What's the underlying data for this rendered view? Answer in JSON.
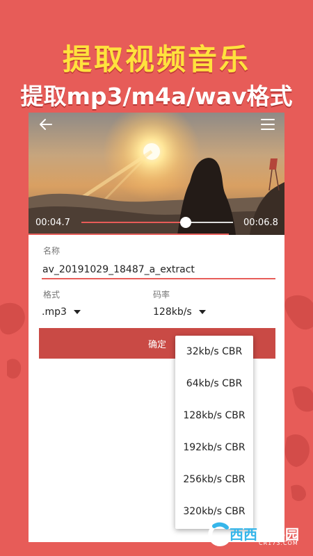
{
  "promo": {
    "headline": "提取视频音乐",
    "subheadline": "提取mp3/m4a/wav格式"
  },
  "player": {
    "current_time": "00:04.7",
    "total_time": "00:06.8",
    "progress": 0.69,
    "back_icon": "arrow-left-icon",
    "menu_icon": "hamburger-menu-icon"
  },
  "form": {
    "name_label": "名称",
    "name_value": "av_20191029_18487_a_extract",
    "format_label": "格式",
    "format_value": ".mp3",
    "bitrate_label": "码率",
    "bitrate_value": "128kb/s",
    "confirm_label": "确定"
  },
  "bitrate_options": [
    "32kb/s CBR",
    "64kb/s CBR",
    "128kb/s CBR",
    "192kb/s CBR",
    "256kb/s CBR",
    "320kb/s CBR"
  ],
  "watermark": {
    "brand_a": "西西",
    "brand_b": "软件园",
    "domain": "CR173.COM"
  },
  "colors": {
    "background": "#e75c58",
    "accent": "#c94a45",
    "headline": "#ffe23d"
  }
}
